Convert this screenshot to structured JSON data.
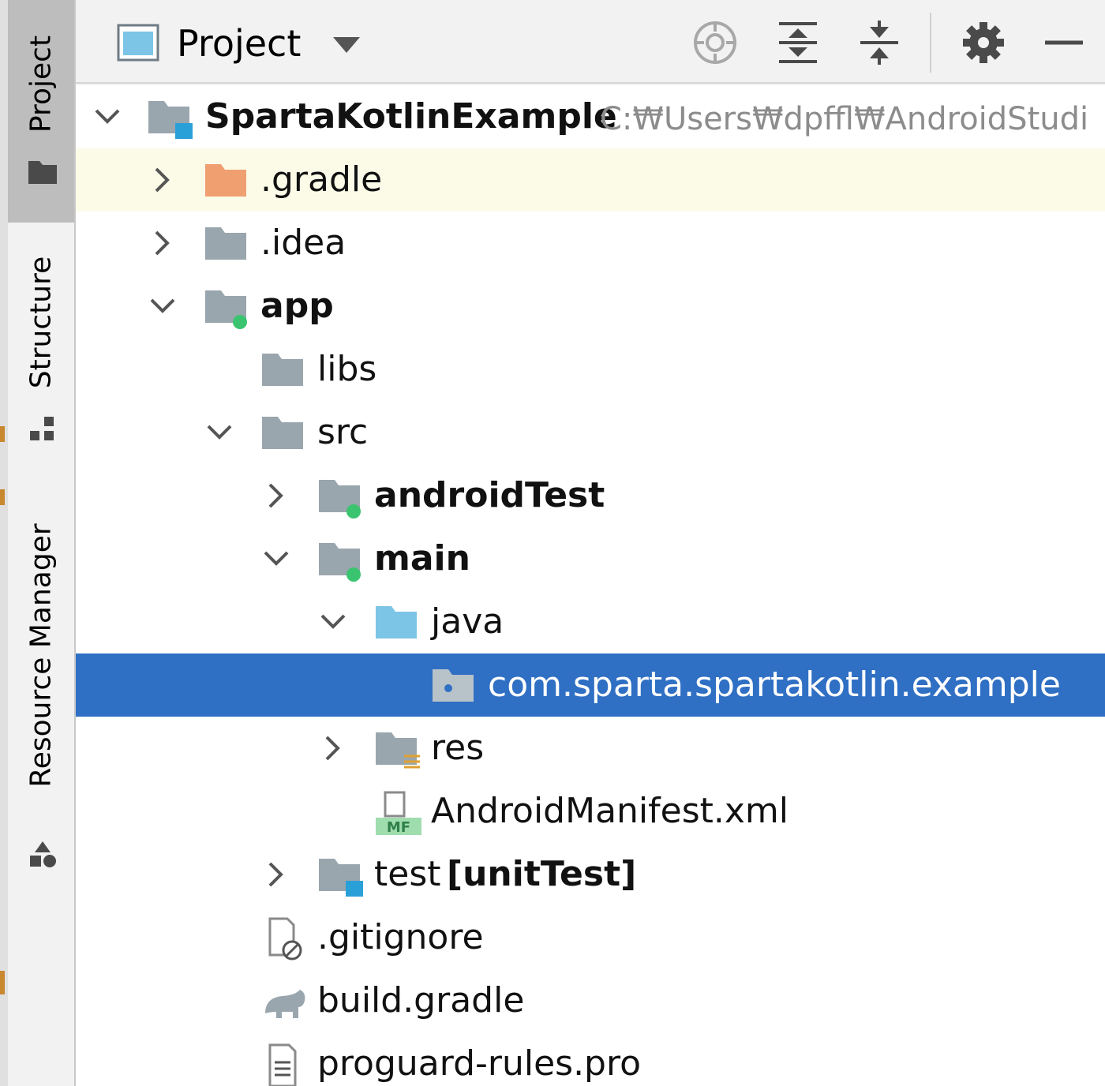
{
  "tool_strip": {
    "project_label": "Project",
    "structure_label": "Structure",
    "resource_manager_label": "Resource Manager"
  },
  "header": {
    "view_label": "Project"
  },
  "tree": {
    "root": {
      "label": "SpartaKotlinExample",
      "path": "C:₩Users₩dpffl₩AndroidStudi"
    },
    "gradle": ".gradle",
    "idea": ".idea",
    "app": "app",
    "libs": "libs",
    "src": "src",
    "androidTest": "androidTest",
    "main": "main",
    "java": "java",
    "package": "com.sparta.spartakotlin.example",
    "res": "res",
    "manifest": "AndroidManifest.xml",
    "test_name": "test",
    "test_tag": "[unitTest]",
    "gitignore": ".gitignore",
    "build_gradle": "build.gradle",
    "proguard": "proguard-rules.pro"
  },
  "colors": {
    "selection": "#2f6fc4",
    "highlight_row": "#fbfbe8",
    "folder_gray": "#9aa6ae",
    "folder_orange": "#f0a070",
    "folder_blue": "#7cc5e6",
    "module_dot": "#3bc46f",
    "test_square": "#2aa0d8"
  }
}
